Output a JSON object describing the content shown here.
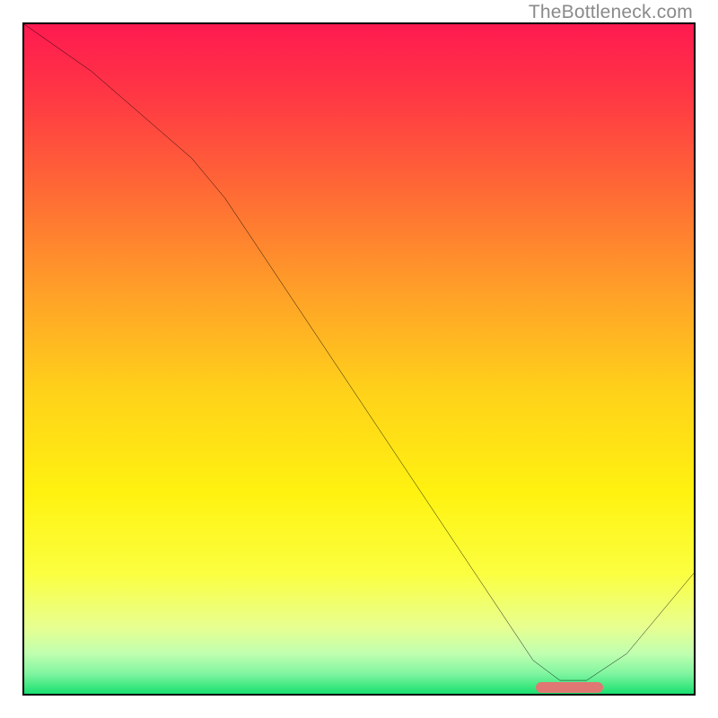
{
  "watermark": "TheBottleneck.com",
  "chart_data": {
    "type": "line",
    "title": "",
    "xlabel": "",
    "ylabel": "",
    "xlim": [
      0,
      100
    ],
    "ylim": [
      0,
      100
    ],
    "grid": false,
    "series": [
      {
        "name": "curve",
        "color": "#000000",
        "x": [
          0,
          10,
          25,
          30,
          40,
          50,
          60,
          70,
          76,
          80,
          84,
          90,
          100
        ],
        "y": [
          100,
          93,
          80,
          74,
          59,
          44,
          29,
          14,
          5,
          2,
          2,
          6,
          18
        ]
      }
    ],
    "marker": {
      "x_start": 76,
      "x_end": 86,
      "y": 1,
      "color": "#e17773"
    },
    "background_gradient": {
      "stops": [
        {
          "pos": 0.0,
          "color": "#ff1a50"
        },
        {
          "pos": 0.1,
          "color": "#ff3545"
        },
        {
          "pos": 0.25,
          "color": "#ff6a35"
        },
        {
          "pos": 0.4,
          "color": "#ffa028"
        },
        {
          "pos": 0.55,
          "color": "#ffd21a"
        },
        {
          "pos": 0.7,
          "color": "#fff210"
        },
        {
          "pos": 0.82,
          "color": "#fbff40"
        },
        {
          "pos": 0.9,
          "color": "#e8ff90"
        },
        {
          "pos": 0.94,
          "color": "#c0ffb0"
        },
        {
          "pos": 0.97,
          "color": "#80f5a0"
        },
        {
          "pos": 1.0,
          "color": "#19e070"
        }
      ]
    }
  }
}
